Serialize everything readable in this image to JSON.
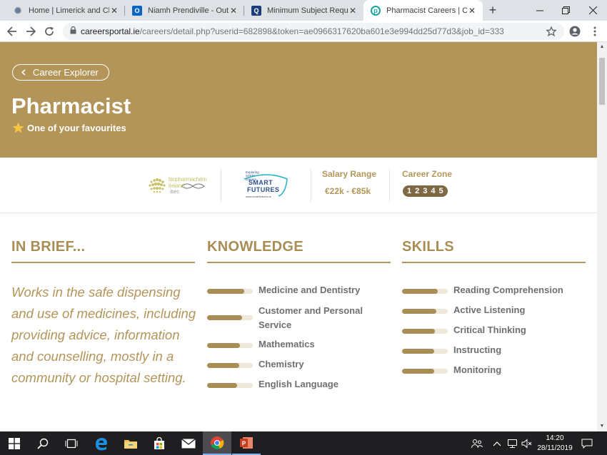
{
  "browser": {
    "tabs": [
      {
        "title": "Home | Limerick and Clare",
        "icon": "gear-favicon-icon"
      },
      {
        "title": "Niamh Prendiville - Outlook",
        "icon": "outlook-favicon-icon"
      },
      {
        "title": "Minimum Subject Requirements",
        "icon": "qualifax-favicon-icon"
      },
      {
        "title": "Pharmacist Careers | Careers",
        "icon": "careersportal-favicon-icon"
      }
    ],
    "close_glyph": "✕",
    "new_tab_glyph": "+",
    "url_host": "careersportal.ie",
    "url_path": "/careers/detail.php?userid=682898&token=ae0966317620ba601e3e994dd25d77d3&job_id=333"
  },
  "hero": {
    "back_label": "Career Explorer",
    "title": "Pharmacist",
    "favourite_label": "One of your favourites"
  },
  "info": {
    "logo1_text": "biopharmachem ireland",
    "logo1_sub": "ibec",
    "logo2_small": "Exploring STEM careers",
    "logo2_main1": "SMART",
    "logo2_main2": "FUTURES",
    "logo2_url": "www.smartfutures.ie",
    "salary_label": "Salary Range",
    "salary_value": "€22k - €85k",
    "zone_label": "Career Zone",
    "zones": [
      "1",
      "2",
      "3",
      "4",
      "5"
    ]
  },
  "brief": {
    "heading": "IN BRIEF...",
    "text": "Works in the safe dispensing and use of medicines, including providing advice, information and counselling, mostly in a community or hospital setting."
  },
  "knowledge": {
    "heading": "KNOWLEDGE",
    "items": [
      {
        "label": "Medicine and Dentistry",
        "level": 0.82
      },
      {
        "label": "Customer and Personal Service",
        "level": 0.77
      },
      {
        "label": "Mathematics",
        "level": 0.72
      },
      {
        "label": "Chemistry",
        "level": 0.7
      },
      {
        "label": "English Language",
        "level": 0.66
      }
    ]
  },
  "skills": {
    "heading": "SKILLS",
    "items": [
      {
        "label": "Reading Comprehension",
        "level": 0.78
      },
      {
        "label": "Active Listening",
        "level": 0.75
      },
      {
        "label": "Critical Thinking",
        "level": 0.72
      },
      {
        "label": "Instructing",
        "level": 0.71
      },
      {
        "label": "Monitoring",
        "level": 0.71
      }
    ]
  },
  "taskbar": {
    "time": "14:20",
    "date": "28/11/2019"
  },
  "colors": {
    "brand_gold": "#b3955a",
    "zone_badge": "#7d6a45"
  }
}
